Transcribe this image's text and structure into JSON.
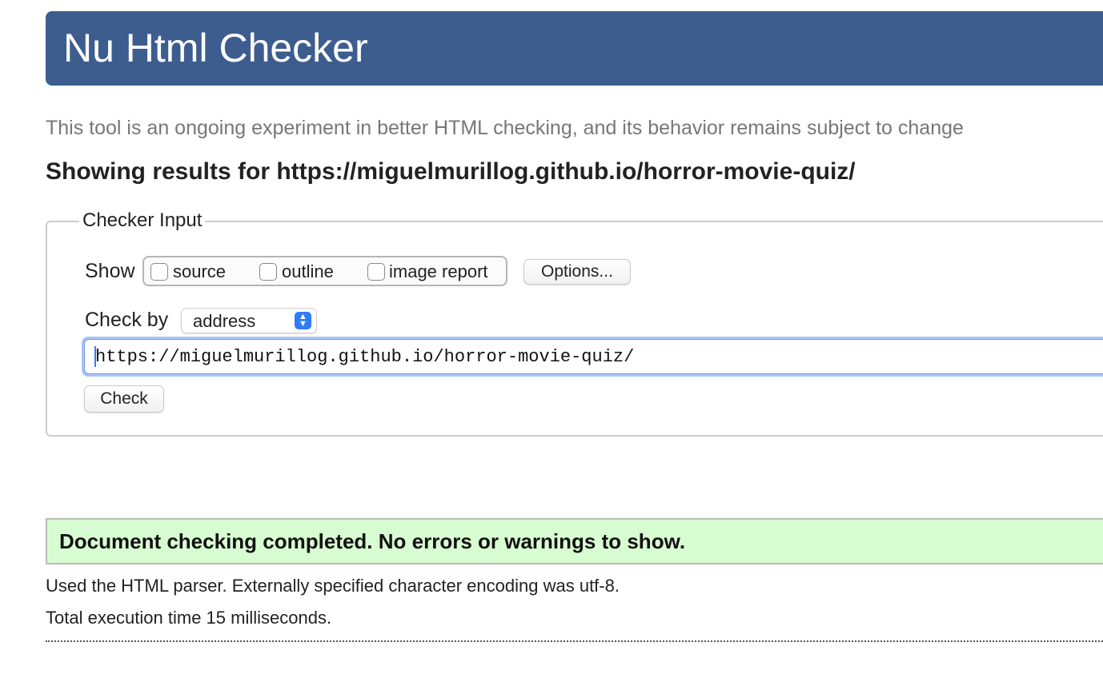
{
  "header": {
    "title": "Nu Html Checker"
  },
  "intro": "This tool is an ongoing experiment in better HTML checking, and its behavior remains subject to change",
  "results_heading": "Showing results for https://miguelmurillog.github.io/horror-movie-quiz/",
  "checker_input": {
    "legend": "Checker Input",
    "show_label": "Show",
    "show_options": [
      {
        "label": "source",
        "checked": false
      },
      {
        "label": "outline",
        "checked": false
      },
      {
        "label": "image report",
        "checked": false
      }
    ],
    "options_button": "Options...",
    "check_by_label": "Check by",
    "check_by_value": "address",
    "url_value": "https://miguelmurillog.github.io/horror-movie-quiz/",
    "check_button": "Check"
  },
  "result": {
    "message": "Document checking completed. No errors or warnings to show.",
    "parser_info": "Used the HTML parser. Externally specified character encoding was utf-8.",
    "execution_time": "Total execution time 15 milliseconds."
  },
  "colors": {
    "header_bg": "#3d5d8f",
    "success_bg": "#d8fcd1",
    "focus_ring": "#a9c4f5",
    "select_accent": "#2f7cf6"
  }
}
